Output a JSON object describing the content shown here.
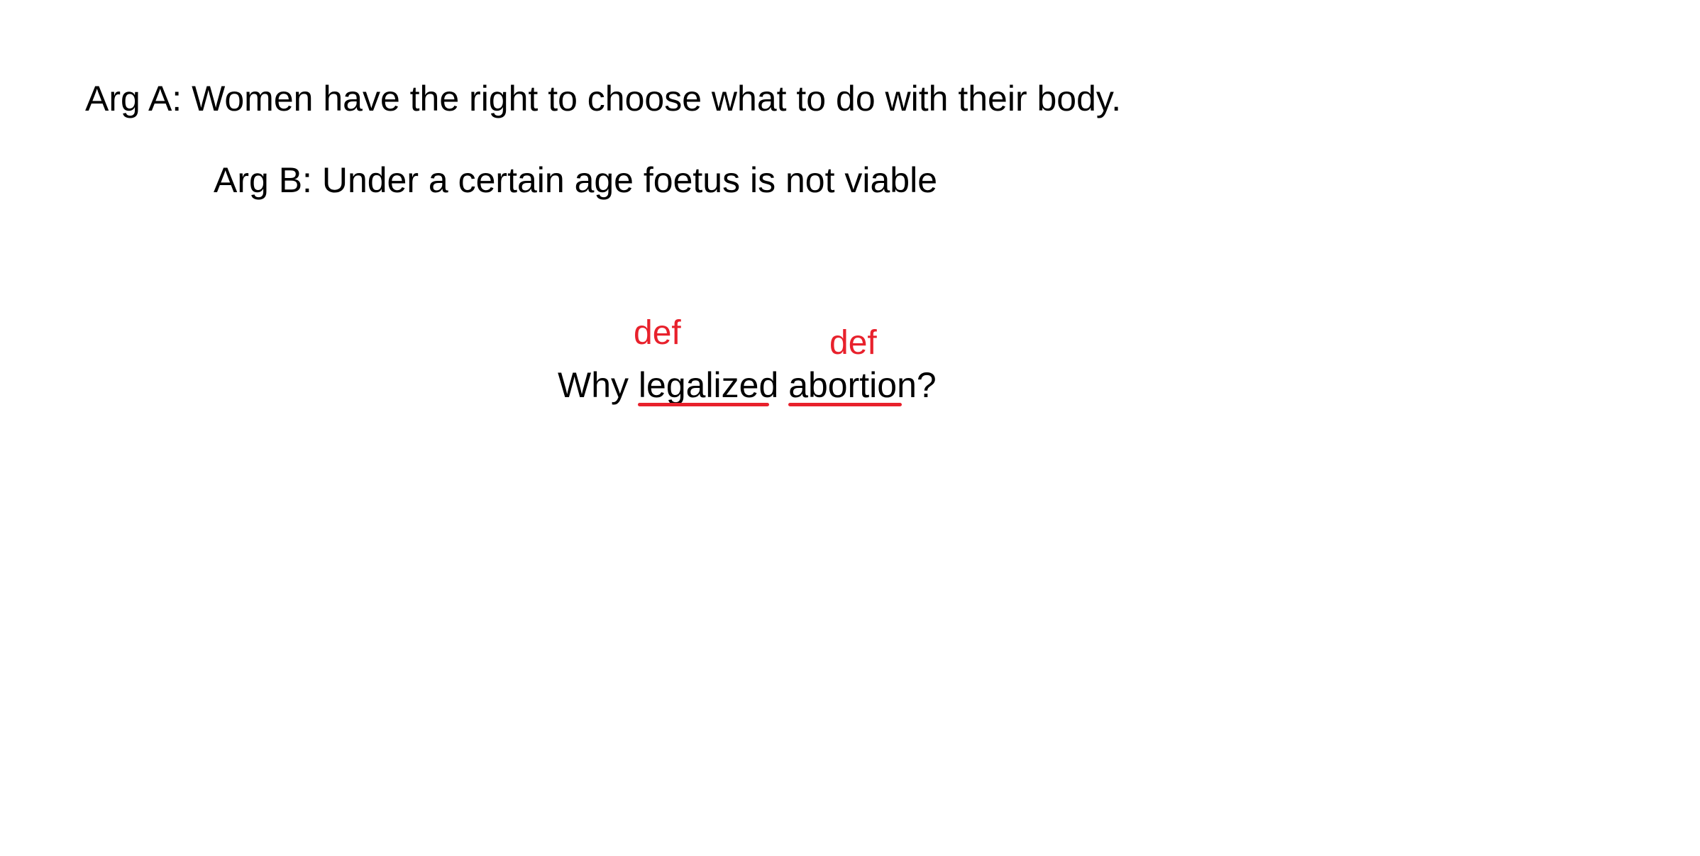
{
  "arg_a": "Arg A: Women have the right to choose what to do with their body.",
  "arg_b": "Arg B: Under a certain age foetus is not viable",
  "question": {
    "prefix": "Why ",
    "word1": "legalized",
    "space": " ",
    "word2": "abortion",
    "suffix": "?"
  },
  "annotations": {
    "def_1": "def",
    "def_2": "def"
  },
  "colors": {
    "text": "#000000",
    "annotation": "#e8212c",
    "background": "#ffffff"
  }
}
